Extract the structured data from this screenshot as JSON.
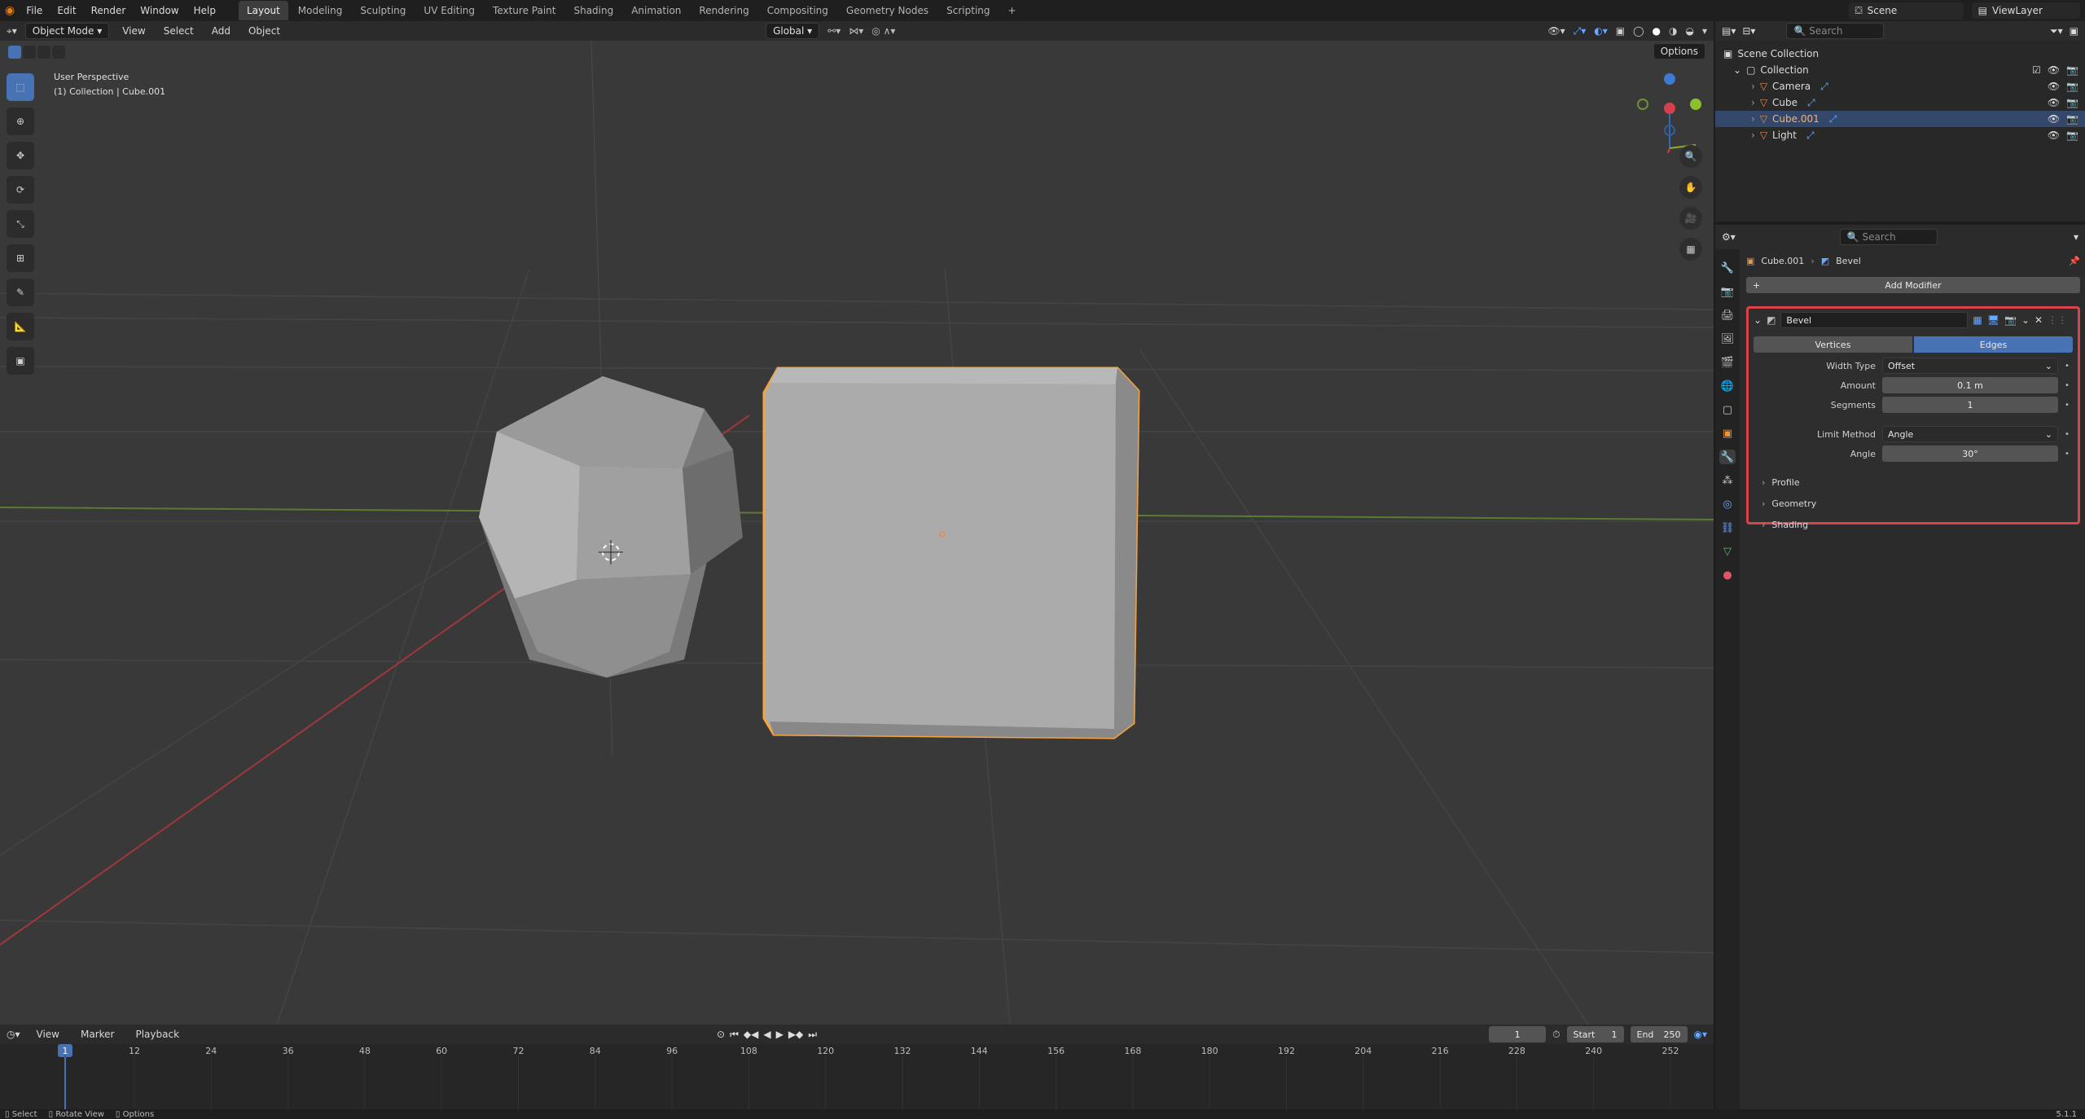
{
  "topbar": {
    "menus": [
      "File",
      "Edit",
      "Render",
      "Window",
      "Help"
    ],
    "workspaces": [
      "Layout",
      "Modeling",
      "Sculpting",
      "UV Editing",
      "Texture Paint",
      "Shading",
      "Animation",
      "Rendering",
      "Compositing",
      "Geometry Nodes",
      "Scripting"
    ],
    "active_workspace": "Layout",
    "scene": "Scene",
    "view_layer": "ViewLayer"
  },
  "viewport_header": {
    "mode": "Object Mode",
    "menus": [
      "View",
      "Select",
      "Add",
      "Object"
    ],
    "orientation": "Global",
    "options": "Options"
  },
  "viewport": {
    "view_name": "User Perspective",
    "context": "(1) Collection | Cube.001"
  },
  "outliner": {
    "search_placeholder": "Search",
    "root": "Scene Collection",
    "collection": "Collection",
    "items": [
      {
        "name": "Camera",
        "selected": false,
        "color": "#e58a54"
      },
      {
        "name": "Cube",
        "selected": false,
        "color": "#e58a54"
      },
      {
        "name": "Cube.001",
        "selected": true,
        "color": "#e58a54"
      },
      {
        "name": "Light",
        "selected": false,
        "color": "#e58a54"
      }
    ]
  },
  "properties": {
    "search_placeholder": "Search",
    "breadcrumb_object": "Cube.001",
    "breadcrumb_modifier": "Bevel",
    "add_modifier": "Add Modifier",
    "modifier_name": "Bevel",
    "affect_vertices": "Vertices",
    "affect_edges": "Edges",
    "rows": [
      {
        "label": "Width Type",
        "value": "Offset",
        "kind": "select"
      },
      {
        "label": "Amount",
        "value": "0.1 m",
        "kind": "number"
      },
      {
        "label": "Segments",
        "value": "1",
        "kind": "number"
      },
      {
        "label": "Limit Method",
        "value": "Angle",
        "kind": "select"
      },
      {
        "label": "Angle",
        "value": "30°",
        "kind": "number"
      }
    ],
    "subpanels": [
      "Profile",
      "Geometry",
      "Shading"
    ],
    "highlight_color": "#d9434a"
  },
  "timeline": {
    "menus": [
      "View",
      "Marker",
      "Playback"
    ],
    "current_frame": "1",
    "start_label": "Start",
    "start": "1",
    "end_label": "End",
    "end": "250",
    "ticks": [
      "1",
      "12",
      "24",
      "36",
      "48",
      "60",
      "72",
      "84",
      "96",
      "108",
      "120",
      "132",
      "144",
      "156",
      "168",
      "180",
      "192",
      "204",
      "216",
      "228",
      "240",
      "252"
    ]
  },
  "statusbar": {
    "items": [
      "Select",
      "Rotate View",
      "Options"
    ],
    "version": "5.1.1"
  }
}
